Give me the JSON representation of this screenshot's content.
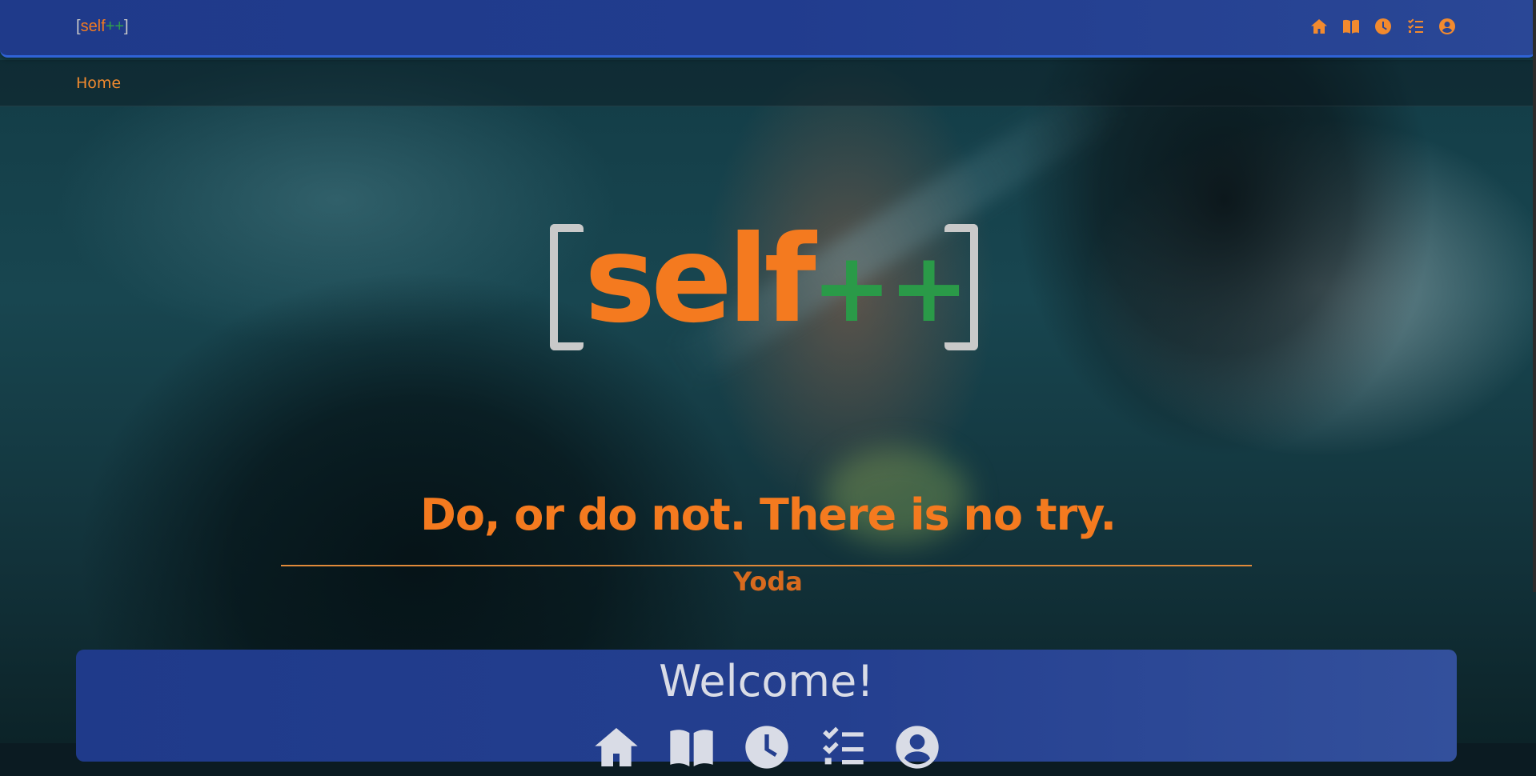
{
  "app": {
    "brand_open": "[",
    "brand_self": "self",
    "brand_plus": "++",
    "brand_close": "]"
  },
  "nav": {
    "icons": [
      "home-icon",
      "book-icon",
      "clock-icon",
      "tasks-icon",
      "user-circle-icon"
    ]
  },
  "breadcrumb": {
    "home": "Home"
  },
  "hero": {
    "logo_self": "self",
    "logo_plus": "++"
  },
  "quote": {
    "text": "Do, or do not. There is no try.",
    "author": "Yoda"
  },
  "welcome": {
    "title": "Welcome!",
    "icons": [
      "home-icon",
      "book-icon",
      "clock-icon",
      "tasks-icon",
      "user-circle-icon"
    ]
  },
  "colors": {
    "accent_orange": "#f47a1f",
    "accent_green": "#2a9a48",
    "bar_blue": "#1f3a8a",
    "bar_border": "#2f63d6"
  }
}
